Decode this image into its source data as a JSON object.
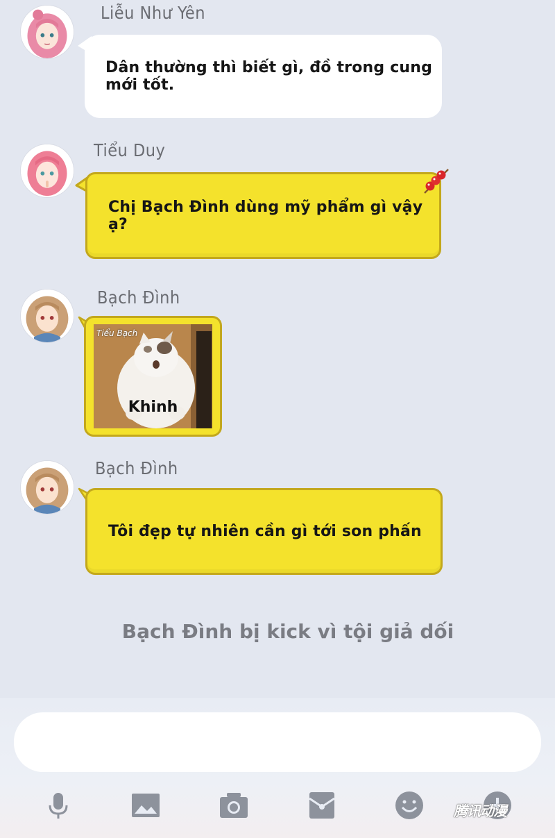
{
  "messages": [
    {
      "sender": "Liễu Như Yên",
      "text": "Dân thường thì biết gì, đồ trong cung mới tốt.",
      "style": "white"
    },
    {
      "sender": "Tiểu Duy",
      "text": "Chị Bạch Đình dùng mỹ phẩm gì vậy ạ?",
      "style": "yellow"
    },
    {
      "sender": "Bạch Đình",
      "sticker_caption": "Khinh",
      "sticker_tag": "Tiểu Bạch",
      "style": "sticker"
    },
    {
      "sender": "Bạch Đình",
      "text": "Tôi đẹp tự nhiên cần gì tới son phấn",
      "style": "yellow"
    }
  ],
  "system_message": "Bạch Đình bị kick vì tội giả dối",
  "toolbar": {
    "icons": [
      "microphone-icon",
      "image-icon",
      "camera-icon",
      "red-envelope-icon",
      "emoji-icon",
      "plus-icon"
    ],
    "watermark": "腾讯动漫"
  },
  "colors": {
    "background": "#e3e7f0",
    "bubble_yellow": "#f4e22c",
    "bubble_border": "#c3a81c",
    "bubble_white": "#ffffff",
    "icon_gray": "#8d929c"
  }
}
